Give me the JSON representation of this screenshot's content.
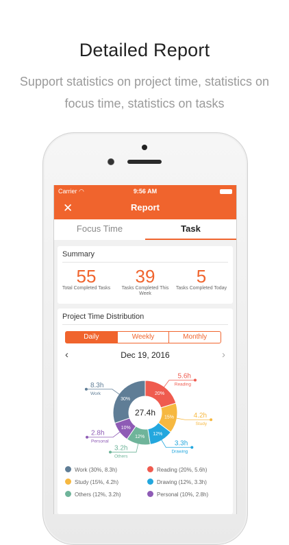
{
  "headline": "Detailed Report",
  "subline": "Support statistics on project time, statistics on focus time, statistics on tasks",
  "status": {
    "carrier": "Carrier",
    "time": "9:56 AM"
  },
  "nav": {
    "title": "Report"
  },
  "tabs": [
    {
      "label": "Focus Time"
    },
    {
      "label": "Task"
    }
  ],
  "summary": {
    "title": "Summary",
    "stats": [
      {
        "value": "55",
        "label": "Total Completed Tasks"
      },
      {
        "value": "39",
        "label": "Tasks Completed This Week"
      },
      {
        "value": "5",
        "label": "Tasks Completed Today"
      }
    ]
  },
  "distribution": {
    "title": "Project Time Distribution",
    "segments": [
      "Daily",
      "Weekly",
      "Monthly"
    ],
    "date": "Dec 19, 2016",
    "total": "27.4h"
  },
  "chart_data": {
    "type": "pie",
    "center_label": "27.4h",
    "slices": [
      {
        "name": "Reading",
        "hours": "5.6h",
        "value": 20,
        "pct_label": "20%",
        "color": "#ef5b4f"
      },
      {
        "name": "Study",
        "hours": "4.2h",
        "value": 15,
        "pct_label": "15%",
        "color": "#f6b840"
      },
      {
        "name": "Drawing",
        "hours": "3.3h",
        "value": 12,
        "pct_label": "12%",
        "color": "#23a7de"
      },
      {
        "name": "Others",
        "hours": "3.2h",
        "value": 12,
        "pct_label": "12%",
        "color": "#6fb49a"
      },
      {
        "name": "Personal",
        "hours": "2.8h",
        "value": 10,
        "pct_label": "10%",
        "color": "#8e5bb5"
      },
      {
        "name": "Work",
        "hours": "8.3h",
        "value": 30,
        "pct_label": "30%",
        "color": "#5f7d96"
      }
    ]
  },
  "legend": [
    {
      "text": "Work (30%, 8.3h)",
      "color": "#5f7d96"
    },
    {
      "text": "Reading (20%, 5.6h)",
      "color": "#ef5b4f"
    },
    {
      "text": "Study (15%, 4.2h)",
      "color": "#f6b840"
    },
    {
      "text": "Drawing (12%, 3.3h)",
      "color": "#23a7de"
    },
    {
      "text": "Others (12%, 3.2h)",
      "color": "#6fb49a"
    },
    {
      "text": "Personal (10%, 2.8h)",
      "color": "#8e5bb5"
    }
  ]
}
